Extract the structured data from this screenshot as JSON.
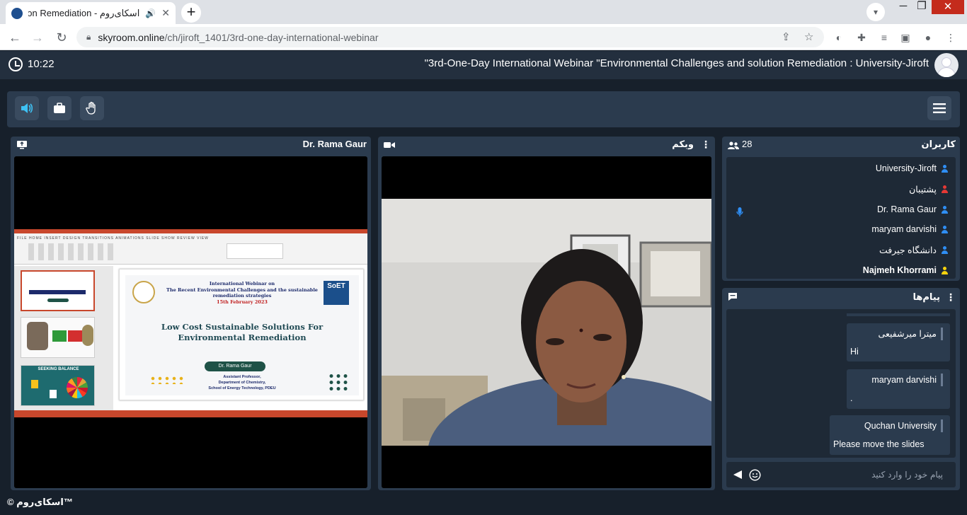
{
  "browser": {
    "tab_title": "اسکای‌روم - lution Remediation",
    "url_domain": "skyroom.online",
    "url_path": "/ch/jiroft_1401/3rd-one-day-international-webinar",
    "new_tab_symbol": "+",
    "window_controls": [
      "─",
      "❐",
      "✕"
    ]
  },
  "header": {
    "time": "10:22",
    "room_title": "\"3rd-One-Day International Webinar \"Environmental Challenges and solution Remediation : University-Jiroft"
  },
  "toolbar": {
    "buttons": [
      {
        "name": "speaker",
        "icon": "speaker-icon",
        "active": true
      },
      {
        "name": "briefcase",
        "icon": "briefcase-icon",
        "active": false
      },
      {
        "name": "raise-hand",
        "icon": "hand-icon",
        "active": false
      }
    ],
    "menu_icon": "hamburger-menu-icon"
  },
  "presenter_panel": {
    "name": "Dr. Rama Gaur",
    "slide": {
      "intro_line1": "International Webinar on",
      "intro_line2": "The Recent Environmental Challenges and the sustainable remediation strategies",
      "date": "15th February 2023",
      "title_line1": "Low Cost Sustainable Solutions For",
      "title_line2": "Environmental Remediation",
      "presenter_pill": "Dr. Rama Gaur",
      "aff_line1": "Assistant Professor,",
      "aff_line2": "Department of Chemistry,",
      "aff_line3": "School of Energy Technology, PDEU",
      "logo": "SoET",
      "thumb3_title": "SEEKING BALANCE"
    }
  },
  "webcam_panel": {
    "title": "وبکم"
  },
  "users_panel": {
    "title": "کاربران",
    "count": "28",
    "users": [
      {
        "name": "University-Jiroft",
        "color": "#2f8ef4",
        "bold": false
      },
      {
        "name": "پشتیبان",
        "color": "#e53935",
        "bold": false
      },
      {
        "name": "Dr. Rama Gaur",
        "color": "#2f8ef4",
        "bold": false
      },
      {
        "name": "maryam darvishi",
        "color": "#2f8ef4",
        "bold": false
      },
      {
        "name": "دانشگاه جیرفت",
        "color": "#2f8ef4",
        "bold": false
      },
      {
        "name": "Najmeh Khorrami",
        "color": "#f6d20e",
        "bold": true
      }
    ]
  },
  "chat_panel": {
    "title": "پیام‌ها",
    "messages": [
      {
        "sender": "میترا میرشفیعی",
        "text": "Hi"
      },
      {
        "sender": "maryam darvishi",
        "text": "."
      },
      {
        "sender": "Quchan University",
        "text": "Please move the slides"
      }
    ],
    "input_placeholder": "پیام خود را وارد کنید"
  },
  "footer": {
    "brand": "© اسکای‌روم™"
  },
  "colors": {
    "app_bg": "#17202b",
    "panel_bg": "#2b3b4e",
    "accent_blue": "#2f8ef4",
    "accent_cyan": "#3ec1f3"
  }
}
